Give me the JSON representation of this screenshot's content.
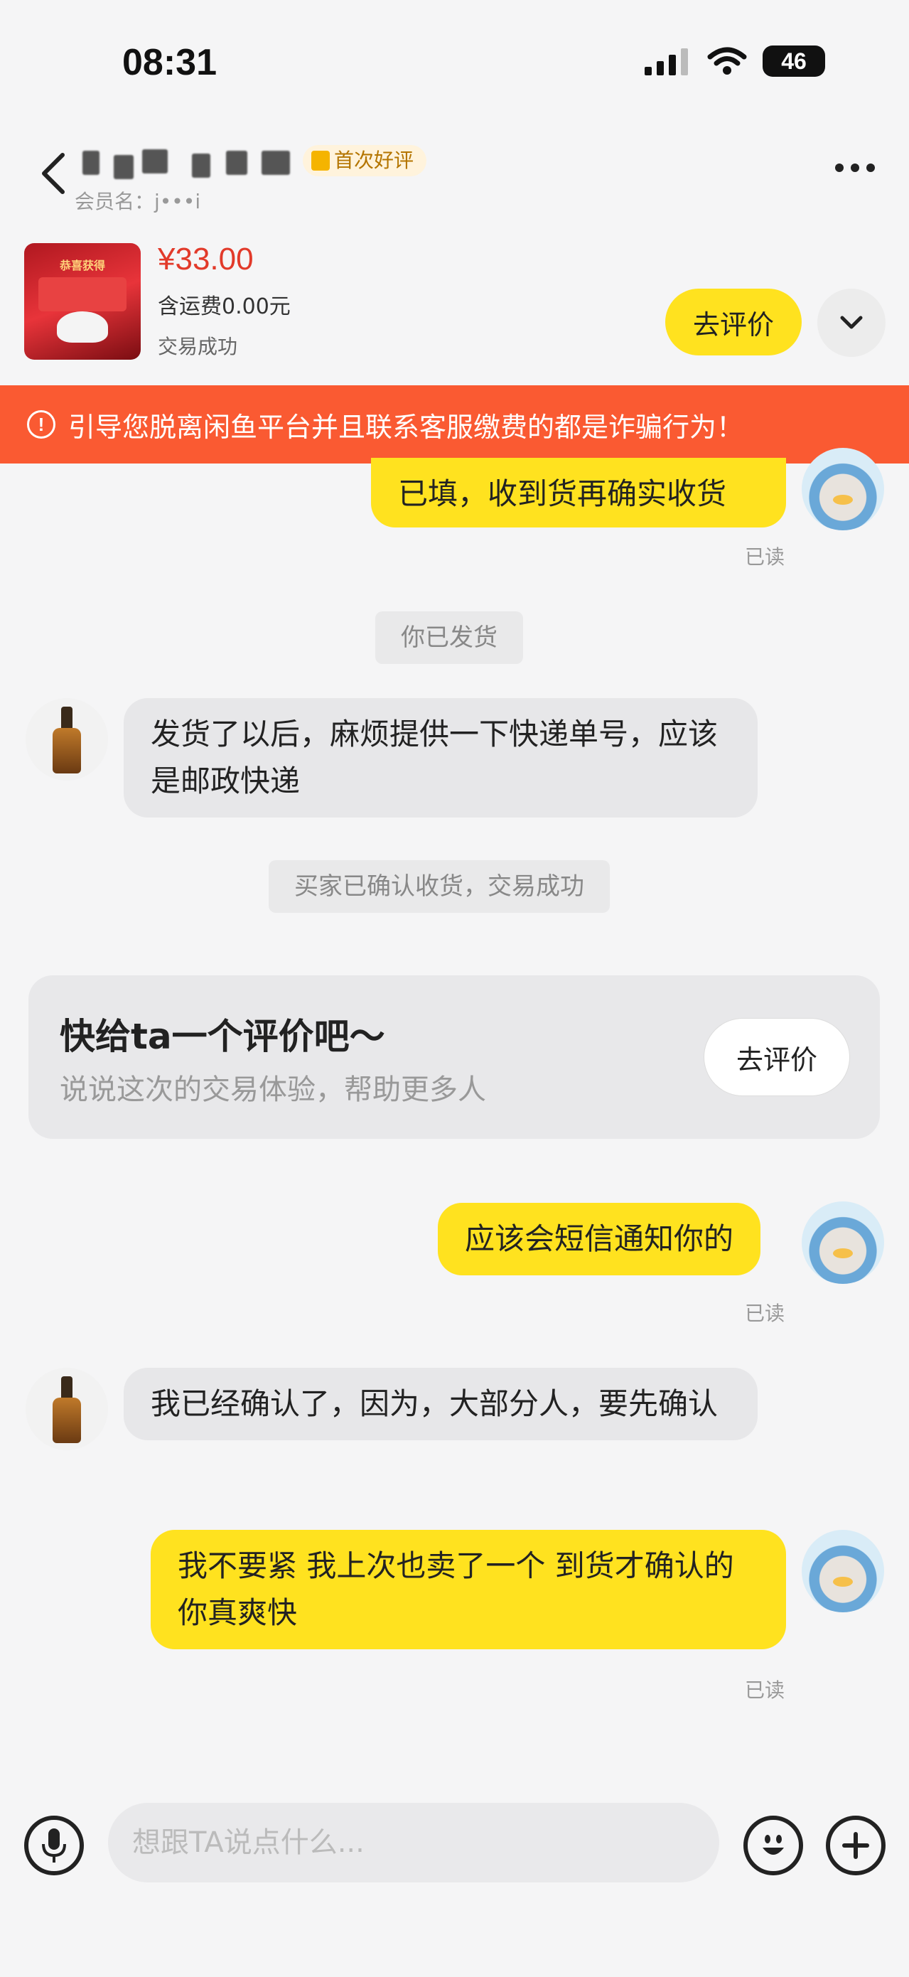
{
  "status_bar": {
    "time": "08:31",
    "battery": "46"
  },
  "header": {
    "praise_badge": "首次好评",
    "member_label": "会员名：j•••i"
  },
  "product": {
    "thumb_text": "恭喜获得",
    "price": "¥33.00",
    "shipping": "含运费0.00元",
    "status": "交易成功",
    "rate_button": "去评价"
  },
  "warning": {
    "text": "引导您脱离闲鱼平台并且联系客服缴费的都是诈骗行为！"
  },
  "messages": {
    "m1": "已填，收到货再确实收货",
    "m1_read": "已读",
    "sys1": "你已发货",
    "m2": "发货了以后，麻烦提供一下快递单号，应该是邮政快递",
    "sys2": "买家已确认收货，交易成功",
    "m3": "应该会短信通知你的",
    "m3_read": "已读",
    "m4": "我已经确认了，因为，大部分人，要先确认",
    "m5": "我不要紧 我上次也卖了一个 到货才确认的 你真爽快",
    "m5_read": "已读"
  },
  "rating_card": {
    "title": "快给ta一个评价吧～",
    "subtitle": "说说这次的交易体验，帮助更多人",
    "button": "去评价"
  },
  "input_bar": {
    "placeholder": "想跟TA说点什么..."
  },
  "colors": {
    "accent_yellow": "#ffe21f",
    "warning_orange": "#fa5a32",
    "price_red": "#e23a2a"
  }
}
